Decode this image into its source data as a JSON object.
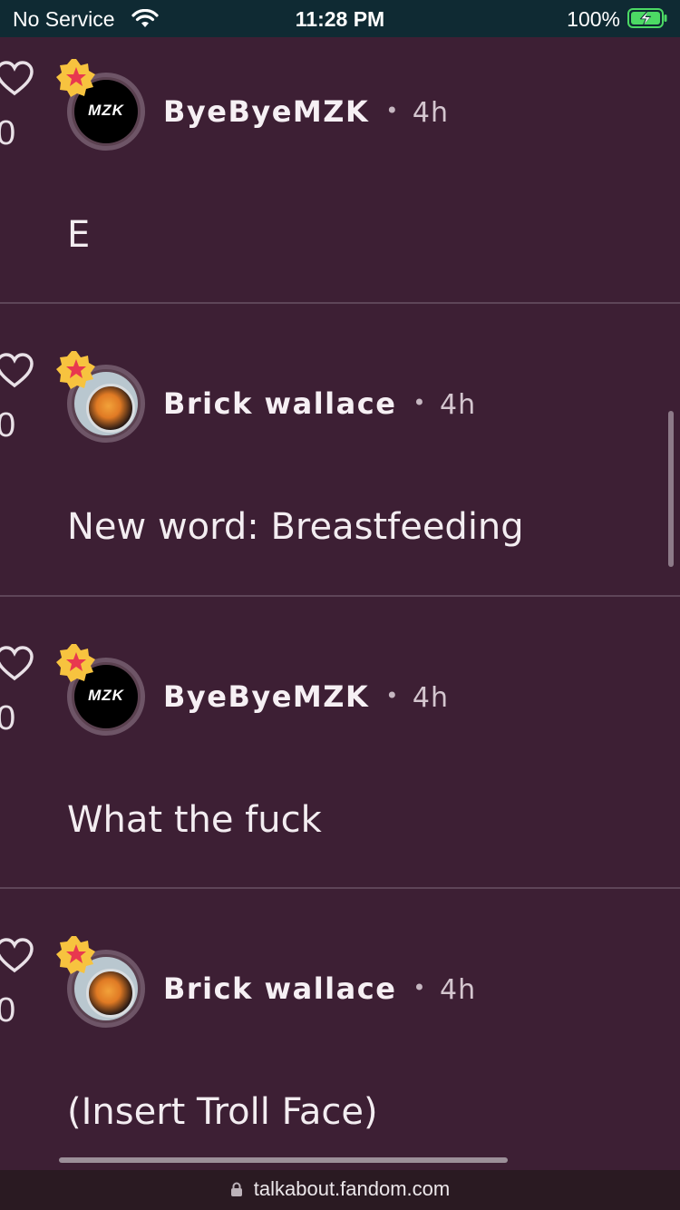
{
  "status_bar": {
    "carrier": "No Service",
    "time": "11:28 PM",
    "battery": "100%"
  },
  "posts": [
    {
      "likes": "0",
      "username": "ByeByeMZK",
      "time": "4h",
      "text": "E",
      "avatar": "mzk",
      "avatar_label": "MZK"
    },
    {
      "likes": "0",
      "username": "Brick wallace",
      "time": "4h",
      "text": "New word: Breastfeeding",
      "avatar": "brick"
    },
    {
      "likes": "0",
      "username": "ByeByeMZK",
      "time": "4h",
      "text": "What the fuck",
      "avatar": "mzk",
      "avatar_label": "MZK"
    },
    {
      "likes": "0",
      "username": "Brick wallace",
      "time": "4h",
      "text": "(Insert Troll Face)",
      "avatar": "brick"
    }
  ],
  "url_bar": {
    "url": "talkabout.fandom.com"
  },
  "colors": {
    "background": "#3d1f34",
    "badge": "#f7c33f",
    "star": "#e8384f"
  }
}
